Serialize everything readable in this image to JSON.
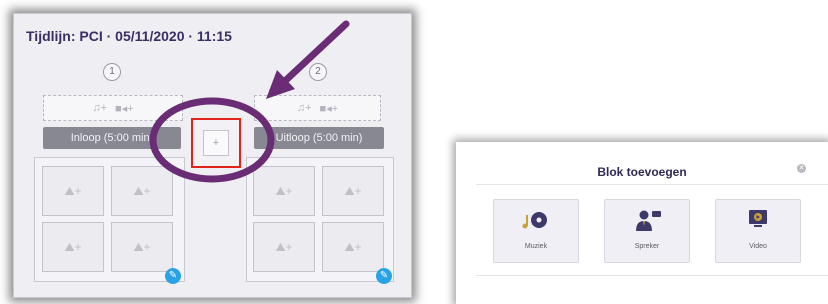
{
  "timeline": {
    "title": "Tijdlijn: PCI · 05/11/2020 · 11:15",
    "blocks": [
      {
        "number": "1",
        "segment_label": "Inloop (5:00 min)"
      },
      {
        "number": "2",
        "segment_label": "Uitloop (5:00 min)"
      }
    ],
    "media_add": {
      "music": "♫+",
      "video": "■◂+"
    },
    "add_block_symbol": "+",
    "slot_symbol": "⛰+",
    "edit_symbol": "✎"
  },
  "modal": {
    "title": "Blok toevoegen",
    "close_symbol": "✕",
    "options": [
      {
        "label": "Muziek",
        "icon": "music-disc-icon"
      },
      {
        "label": "Spreker",
        "icon": "speaker-person-icon"
      },
      {
        "label": "Video",
        "icon": "video-screen-icon"
      }
    ]
  },
  "colors": {
    "title": "#3b2e63",
    "segment": "#878891",
    "highlight_box": "#e2231a",
    "annotation": "#6a2c74",
    "edit_button": "#2aa3e6"
  }
}
